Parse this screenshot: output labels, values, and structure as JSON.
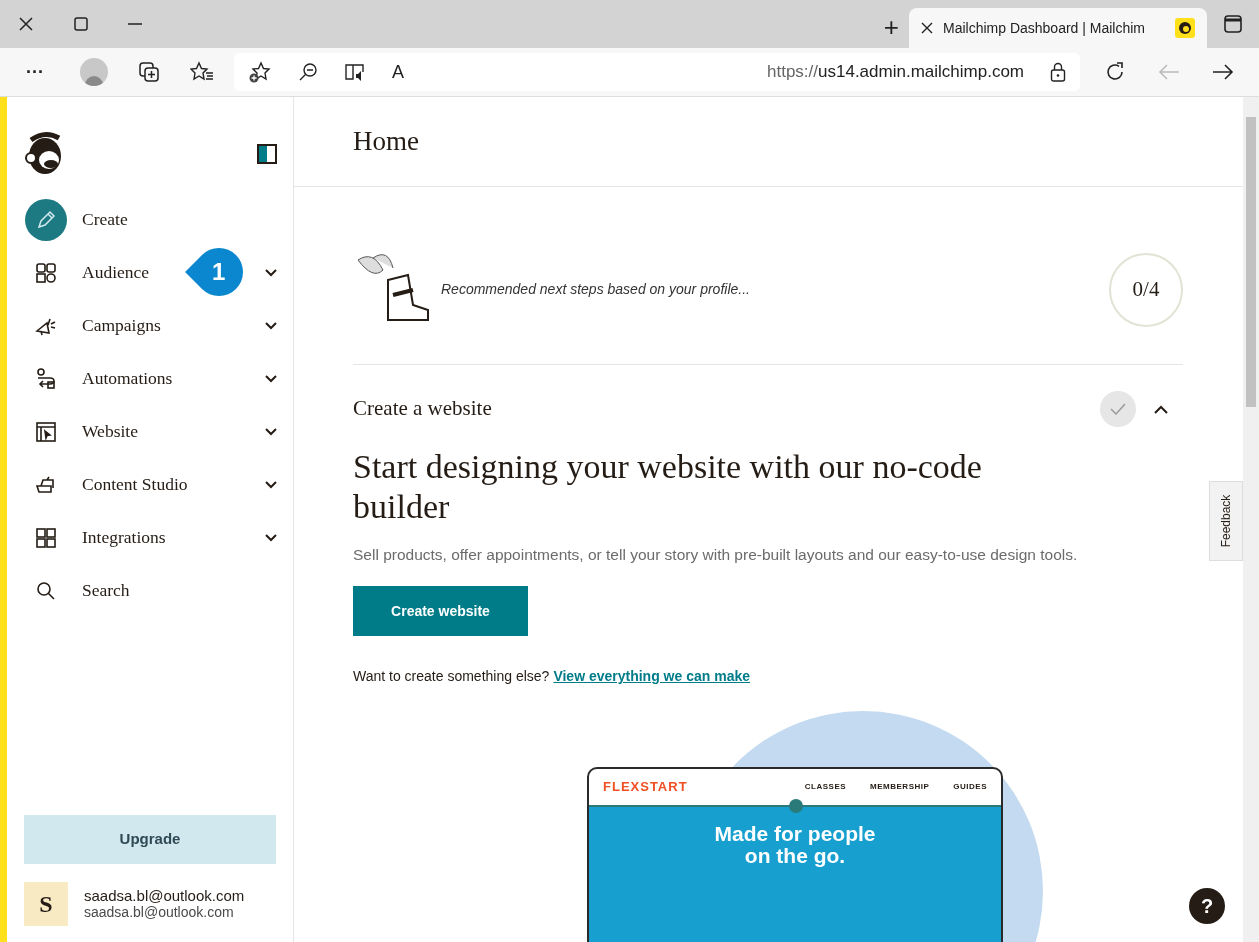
{
  "browser": {
    "tab_title": "Mailchimp Dashboard | Mailchim",
    "tab_selected": true,
    "new_tab": "+",
    "more": "···",
    "url_scheme": "https://",
    "url_host": "us14.admin.mailchimp.com",
    "read_aloud": "A"
  },
  "sidebar": {
    "items": [
      {
        "label": "Create",
        "expandable": false,
        "kind": "create"
      },
      {
        "label": "Audience",
        "expandable": true,
        "kind": "menu"
      },
      {
        "label": "Campaigns",
        "expandable": true,
        "kind": "menu"
      },
      {
        "label": "Automations",
        "expandable": true,
        "kind": "menu"
      },
      {
        "label": "Website",
        "expandable": true,
        "kind": "menu"
      },
      {
        "label": "Content Studio",
        "expandable": true,
        "kind": "menu"
      },
      {
        "label": "Integrations",
        "expandable": true,
        "kind": "menu"
      },
      {
        "label": "Search",
        "expandable": false,
        "kind": "menu"
      }
    ],
    "callout": "1",
    "upgrade": "Upgrade",
    "user": {
      "initial": "S",
      "name": "saadsa.bl@outlook.com",
      "email": "saadsa.bl@outlook.com"
    }
  },
  "main": {
    "title": "Home",
    "recommend": "Recommended next steps based on your profile...",
    "progress": "0/4",
    "section": {
      "title": "Create a website",
      "completed": false,
      "expanded": true,
      "heading": "Start designing your website with our no-code builder",
      "description": "Sell products, offer appointments, or tell your story with pre-built layouts and our easy-to-use design tools.",
      "button": "Create website",
      "prompt": "Want to create something else?",
      "link": "View everything we can make"
    },
    "preview": {
      "brand": "FLEXSTART",
      "nav": [
        "CLASSES",
        "MEMBERSHIP",
        "GUIDES"
      ],
      "hero": [
        "Made for people",
        "on the go."
      ]
    },
    "feedback": "Feedback",
    "help": "?"
  }
}
